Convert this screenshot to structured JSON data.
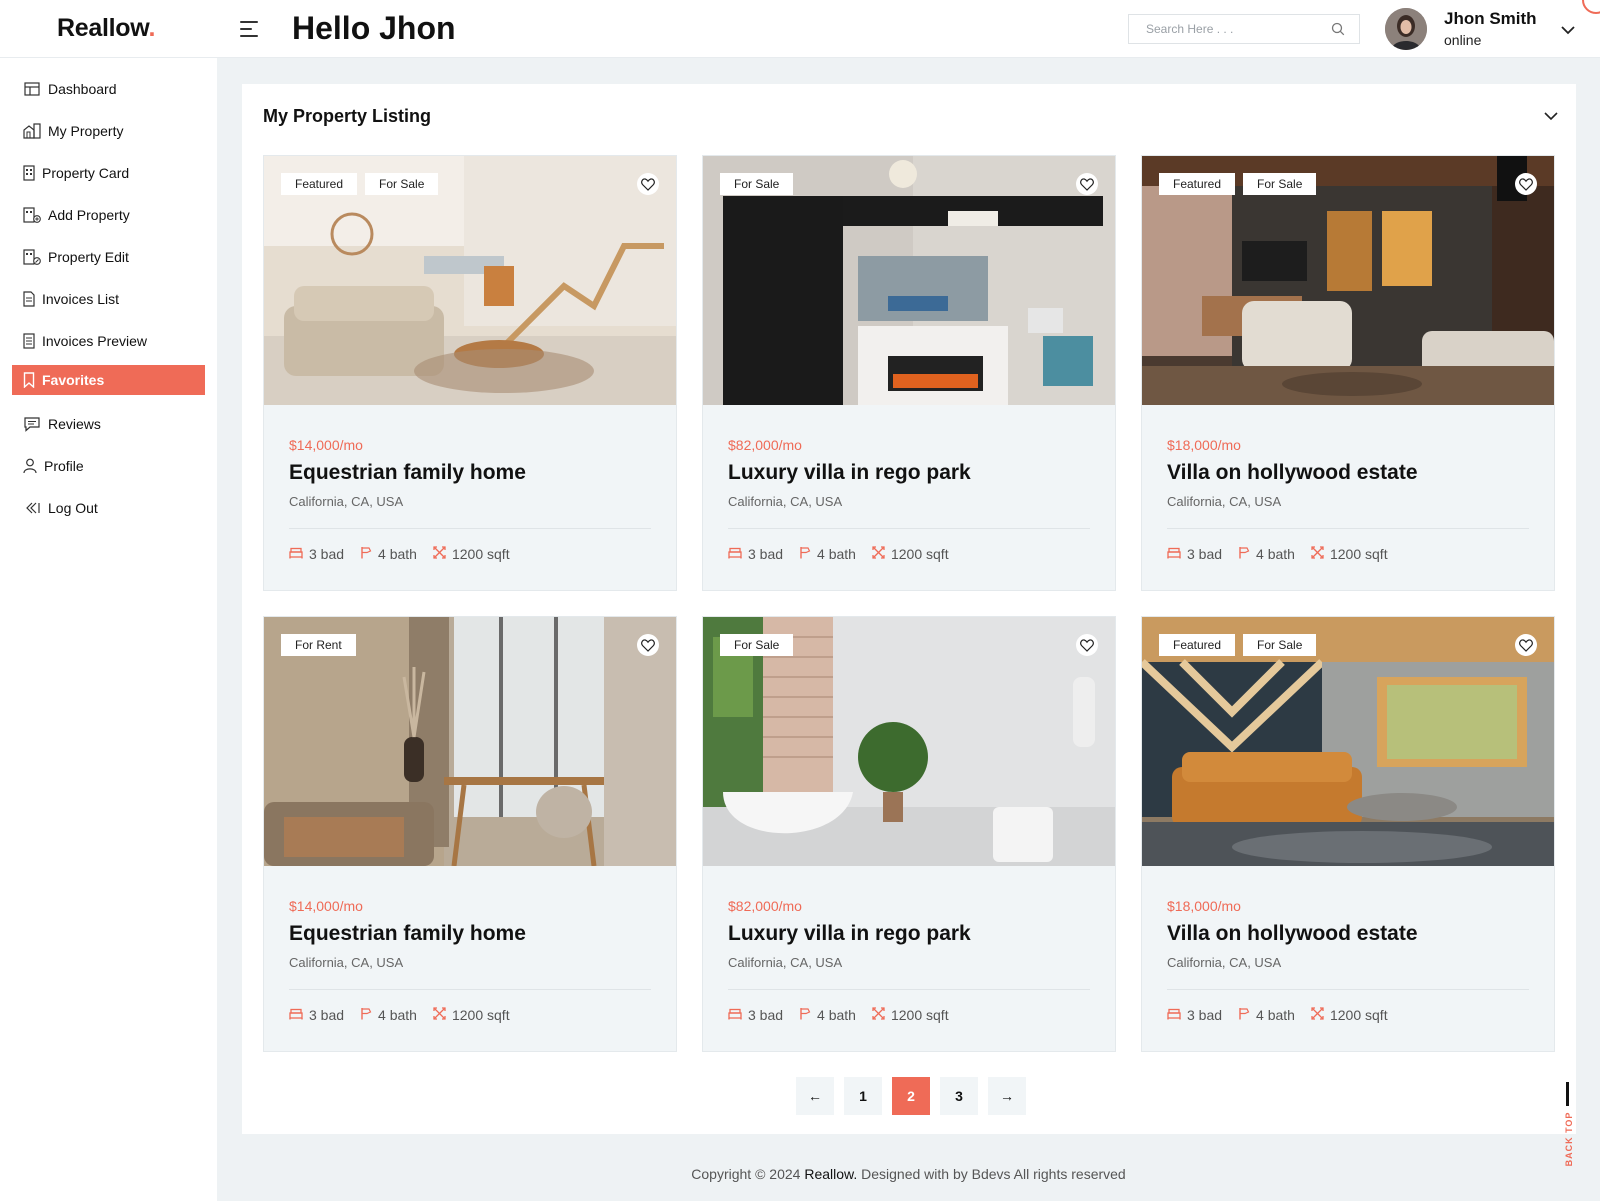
{
  "app": {
    "logo": "Reallow",
    "logo_dot": "."
  },
  "header": {
    "greeting": "Hello Jhon",
    "search_placeholder": "Search Here . . .",
    "user_name": "Jhon Smith",
    "user_status": "online"
  },
  "sidebar": {
    "items": [
      {
        "label": "Dashboard",
        "icon": "dashboard-icon"
      },
      {
        "label": "My Property",
        "icon": "property-icon"
      },
      {
        "label": "Property Card",
        "icon": "card-icon"
      },
      {
        "label": "Add Property",
        "icon": "add-property-icon"
      },
      {
        "label": "Property Edit",
        "icon": "edit-property-icon"
      },
      {
        "label": "Invoices List",
        "icon": "invoice-icon"
      },
      {
        "label": "Invoices Preview",
        "icon": "invoice-preview-icon"
      },
      {
        "label": "Favorites",
        "icon": "bookmark-icon",
        "active": true
      },
      {
        "label": "Reviews",
        "icon": "review-icon"
      },
      {
        "label": "Profile",
        "icon": "user-icon"
      },
      {
        "label": "Log Out",
        "icon": "logout-icon"
      }
    ]
  },
  "main": {
    "title": "My Property Listing",
    "cards": [
      {
        "badges": [
          "Featured",
          "For Sale"
        ],
        "price": "$14,000/mo",
        "title": "Equestrian family home",
        "location": "California, CA, USA",
        "beds": "3 bad",
        "baths": "4 bath",
        "area": "1200 sqft"
      },
      {
        "badges": [
          "For Sale"
        ],
        "price": "$82,000/mo",
        "title": "Luxury villa in rego park",
        "location": "California, CA, USA",
        "beds": "3 bad",
        "baths": "4 bath",
        "area": "1200 sqft"
      },
      {
        "badges": [
          "Featured",
          "For Sale"
        ],
        "price": "$18,000/mo",
        "title": "Villa on hollywood estate",
        "location": "California, CA, USA",
        "beds": "3 bad",
        "baths": "4 bath",
        "area": "1200 sqft"
      },
      {
        "badges": [
          "For Rent"
        ],
        "price": "$14,000/mo",
        "title": "Equestrian family home",
        "location": "California, CA, USA",
        "beds": "3 bad",
        "baths": "4 bath",
        "area": "1200 sqft"
      },
      {
        "badges": [
          "For Sale"
        ],
        "price": "$82,000/mo",
        "title": "Luxury villa in rego park",
        "location": "California, CA, USA",
        "beds": "3 bad",
        "baths": "4 bath",
        "area": "1200 sqft"
      },
      {
        "badges": [
          "Featured",
          "For Sale"
        ],
        "price": "$18,000/mo",
        "title": "Villa on hollywood estate",
        "location": "California, CA, USA",
        "beds": "3 bad",
        "baths": "4 bath",
        "area": "1200 sqft"
      }
    ]
  },
  "pagination": {
    "prev": "←",
    "pages": [
      "1",
      "2",
      "3"
    ],
    "current": "2",
    "next": "→"
  },
  "footer": {
    "prefix": "Copyright © 2024 ",
    "brand": "Reallow.",
    "suffix": " Designed with by Bdevs All rights reserved"
  },
  "back_to_top": "BACK TOP",
  "colors": {
    "accent": "#ef6b57",
    "card_bg": "#f1f5f7",
    "page_bg": "#eef2f4"
  }
}
